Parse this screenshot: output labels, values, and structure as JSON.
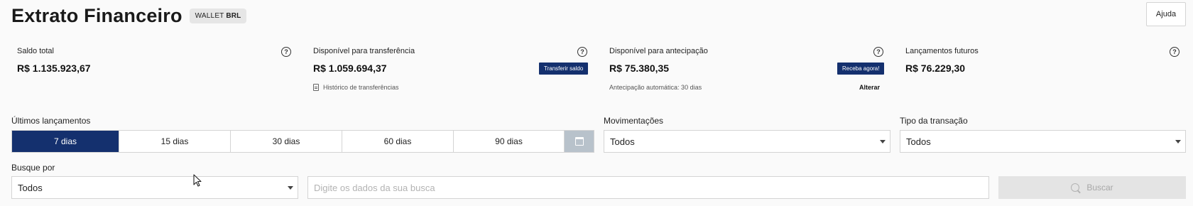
{
  "header": {
    "title": "Extrato Financeiro",
    "wallet_prefix": "WALLET",
    "wallet_currency": "BRL",
    "help_label": "Ajuda"
  },
  "cards": [
    {
      "label": "Saldo total",
      "value": "R$ 1.135.923,67"
    },
    {
      "label": "Disponível para transferência",
      "value": "R$ 1.059.694,37",
      "action": "Transferir saldo",
      "sub": "Histórico de transferências"
    },
    {
      "label": "Disponível para antecipação",
      "value": "R$ 75.380,35",
      "action": "Receba agora!",
      "sub": "Antecipação automática: 30 dias",
      "link": "Alterar"
    },
    {
      "label": "Lançamentos futuros",
      "value": "R$ 76.229,30"
    }
  ],
  "help_glyph": "?",
  "filters": {
    "period_label": "Últimos lançamentos",
    "periods": [
      "7 dias",
      "15 dias",
      "30 dias",
      "60 dias",
      "90 dias"
    ],
    "selected_period": "7 dias",
    "movements_label": "Movimentações",
    "movements_value": "Todos",
    "transaction_type_label": "Tipo da transação",
    "transaction_type_value": "Todos"
  },
  "search": {
    "search_by_label": "Busque por",
    "search_by_value": "Todos",
    "placeholder": "Digite os dados da sua busca",
    "button_label": "Buscar"
  },
  "colors": {
    "primary": "#14306e",
    "calendar_button": "#b8c2cb",
    "disabled_button": "#e4e4e4"
  }
}
